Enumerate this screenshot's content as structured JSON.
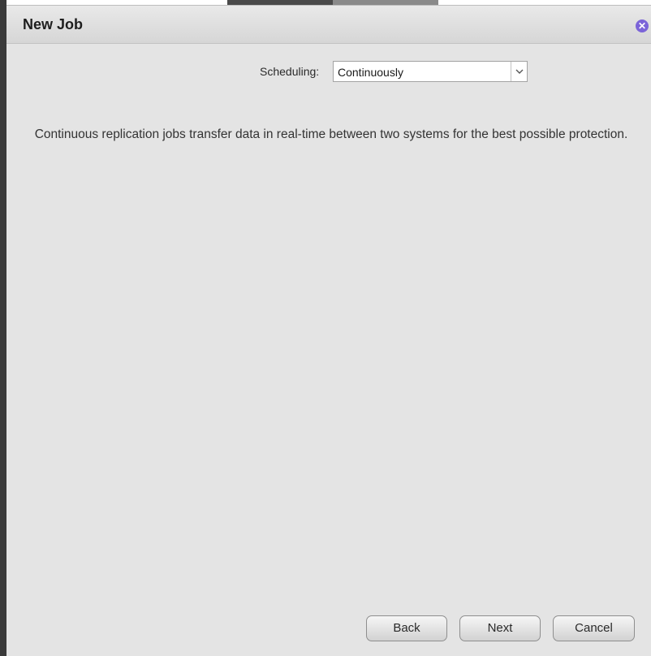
{
  "dialog": {
    "title": "New Job",
    "close_icon": "close-icon"
  },
  "scheduling": {
    "label": "Scheduling:",
    "value": "Continuously"
  },
  "description": "Continuous replication jobs transfer data in real-time between two systems for the best possible protection.",
  "buttons": {
    "back": "Back",
    "next": "Next",
    "cancel": "Cancel"
  },
  "colors": {
    "dialog_bg": "#e4e4e4",
    "close_accent": "#7b64d8"
  }
}
